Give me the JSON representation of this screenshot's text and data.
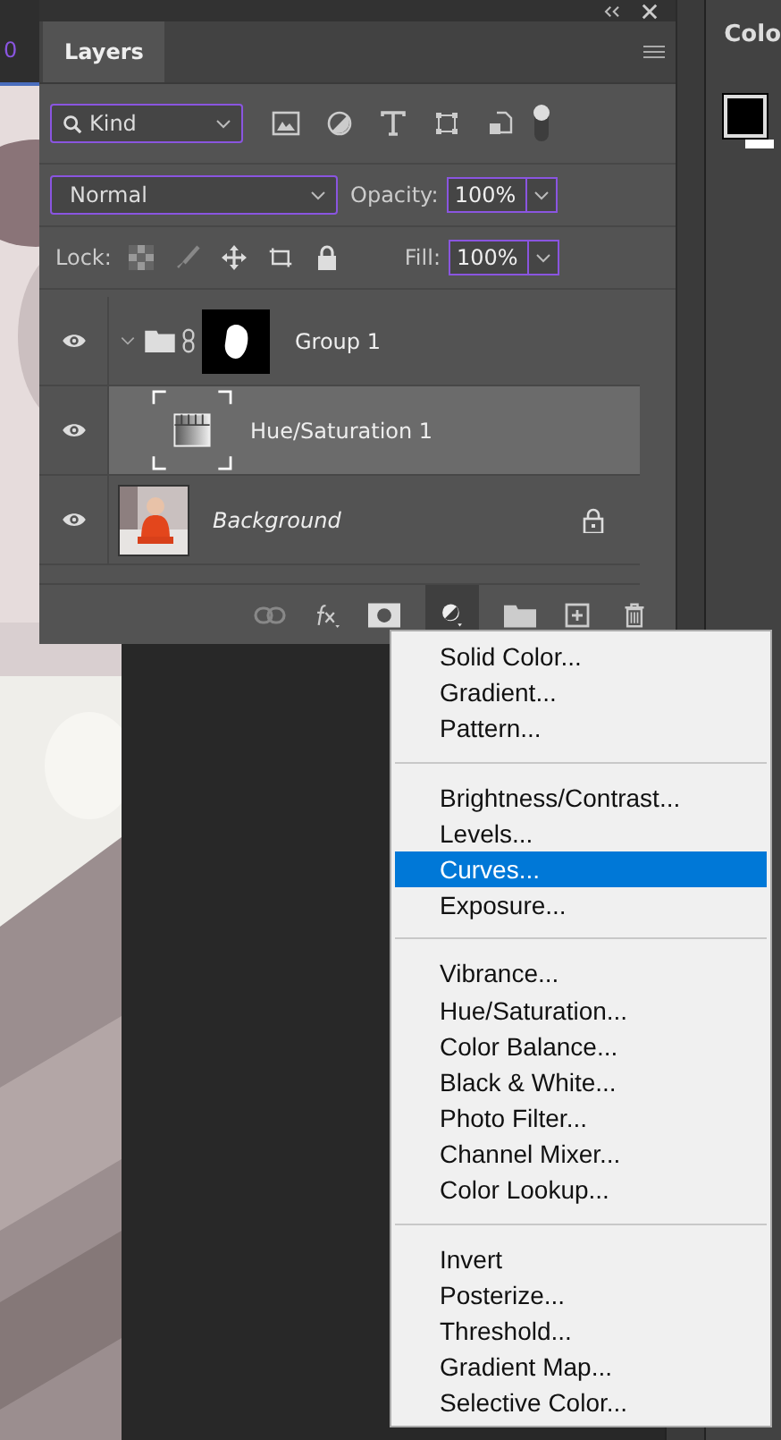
{
  "ruler": {
    "label": "0"
  },
  "layers_panel": {
    "tab": "Layers",
    "filter": {
      "value": "Kind"
    },
    "blend_mode": {
      "value": "Normal"
    },
    "opacity": {
      "label": "Opacity:",
      "value": "100%"
    },
    "lock": {
      "label": "Lock:"
    },
    "fill": {
      "label": "Fill:",
      "value": "100%"
    },
    "layers": [
      {
        "name": "Group 1",
        "kind": "group",
        "visible": true,
        "expanded": true,
        "selected": false,
        "locked": false,
        "children": [
          {
            "name": "Hue/Saturation 1",
            "kind": "adjustment",
            "visible": true,
            "selected": true,
            "locked": false
          }
        ]
      },
      {
        "name": "Background",
        "kind": "pixel",
        "visible": true,
        "selected": false,
        "locked": true
      }
    ]
  },
  "adjustment_menu": {
    "sections": [
      [
        {
          "label": "Solid Color...",
          "selected": false
        },
        {
          "label": "Gradient...",
          "selected": false
        },
        {
          "label": "Pattern...",
          "selected": false
        }
      ],
      [
        {
          "label": "Brightness/Contrast...",
          "selected": false
        },
        {
          "label": "Levels...",
          "selected": false
        },
        {
          "label": "Curves...",
          "selected": true
        },
        {
          "label": "Exposure...",
          "selected": false
        }
      ],
      [
        {
          "label": "Vibrance...",
          "selected": false
        },
        {
          "label": "Hue/Saturation...",
          "selected": false
        },
        {
          "label": "Color Balance...",
          "selected": false
        },
        {
          "label": "Black & White...",
          "selected": false
        },
        {
          "label": "Photo Filter...",
          "selected": false
        },
        {
          "label": "Channel Mixer...",
          "selected": false
        },
        {
          "label": "Color Lookup...",
          "selected": false
        }
      ],
      [
        {
          "label": "Invert",
          "selected": false
        },
        {
          "label": "Posterize...",
          "selected": false
        },
        {
          "label": "Threshold...",
          "selected": false
        },
        {
          "label": "Gradient Map...",
          "selected": false
        },
        {
          "label": "Selective Color...",
          "selected": false
        }
      ]
    ]
  },
  "color_panel": {
    "title": "Colo"
  }
}
